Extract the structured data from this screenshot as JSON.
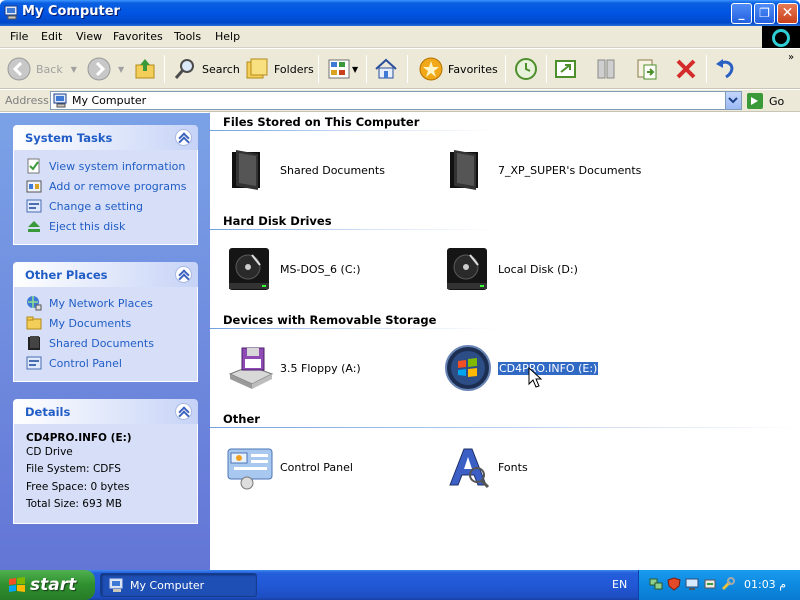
{
  "window": {
    "title": "My Computer",
    "buttons": [
      "_",
      "❐",
      "✕"
    ]
  },
  "menu": [
    "File",
    "Edit",
    "View",
    "Favorites",
    "Tools",
    "Help"
  ],
  "toolbar": {
    "back": "Back",
    "search": "Search",
    "folders": "Folders",
    "favorites": "Favorites"
  },
  "address": {
    "label": "Address",
    "value": "My Computer",
    "go": "Go"
  },
  "tasks": {
    "system": {
      "title": "System Tasks",
      "items": [
        "View system information",
        "Add or remove programs",
        "Change a setting",
        "Eject this disk"
      ]
    },
    "other": {
      "title": "Other Places",
      "items": [
        "My Network Places",
        "My Documents",
        "Shared Documents",
        "Control Panel"
      ]
    },
    "details": {
      "title": "Details",
      "name": "CD4PRO.INFO (E:)",
      "type": "CD Drive",
      "filesystem": "File System: CDFS",
      "free": "Free Space: 0 bytes",
      "total": "Total Size: 693 MB"
    }
  },
  "groups": {
    "files": {
      "title": "Files Stored on This Computer",
      "items": [
        "Shared Documents",
        "7_XP_SUPER's Documents"
      ]
    },
    "disks": {
      "title": "Hard Disk Drives",
      "items": [
        "MS-DOS_6 (C:)",
        "Local Disk (D:)"
      ]
    },
    "removable": {
      "title": "Devices with Removable Storage",
      "items": [
        "3.5 Floppy (A:)",
        "CD4PRO.INFO (E:)"
      ]
    },
    "other": {
      "title": "Other",
      "items": [
        "Control Panel",
        "Fonts"
      ]
    }
  },
  "taskbar": {
    "start": "start",
    "task": "My Computer",
    "lang": "EN",
    "clock": "01:03 م"
  },
  "colors": {
    "titlebar": "#0054e3",
    "taskpane": "#6f8fde",
    "link": "#215dc6",
    "selection": "#316ac5"
  }
}
